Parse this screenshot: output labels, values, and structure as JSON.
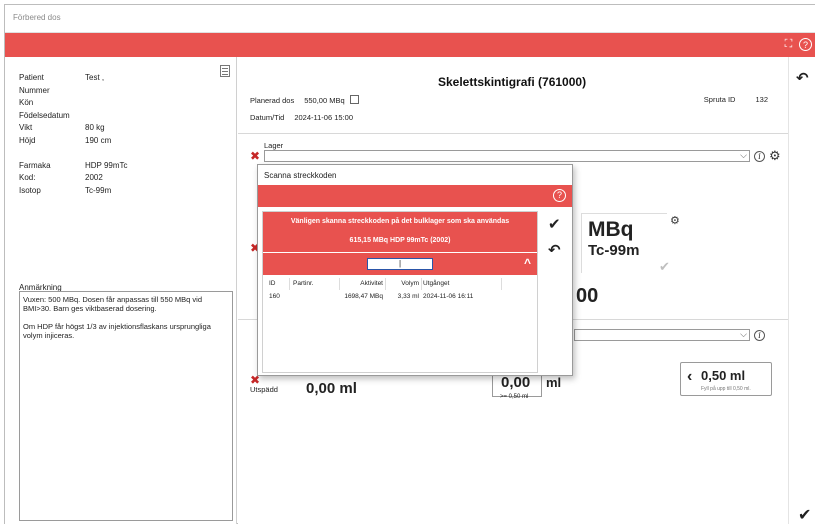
{
  "window": {
    "title": "Förbered dos"
  },
  "patient": {
    "rows": [
      {
        "label": "Patient",
        "value": "Test ,"
      },
      {
        "label": "Nummer",
        "value": ""
      },
      {
        "label": "Kön",
        "value": ""
      },
      {
        "label": "Födelsedatum",
        "value": ""
      },
      {
        "label": "Vikt",
        "value": "80 kg"
      },
      {
        "label": "Höjd",
        "value": "190 cm"
      }
    ],
    "pharma": [
      {
        "label": "Farmaka",
        "value": "HDP 99mTc"
      },
      {
        "label": "Kod:",
        "value": "2002"
      },
      {
        "label": "Isotop",
        "value": "Tc-99m"
      }
    ]
  },
  "notes": {
    "label": "Anmärkning",
    "p1": "Vuxen: 500 MBq. Dosen får anpassas till 550 MBq vid BMI>30. Barn ges viktbaserad dosering.",
    "p2": "Om HDP får högst 1/3 av injektionsflaskans ursprungliga volym injiceras."
  },
  "main": {
    "title": "Skelettskintigrafi (761000)",
    "planned_label": "Planerad dos",
    "planned_value": "550,00 MBq",
    "datetime_label": "Datum/Tid",
    "datetime_value": "2024-11-06 15:00",
    "spruta_label": "Spruta ID",
    "spruta_value": "132",
    "lager_label": "Lager",
    "unit": "MBq",
    "isotope": "Tc-99m",
    "big_value": "00",
    "utspadd_label": "Utspädd",
    "utspadd_value": "0,00 ml",
    "volume_value": "0,00",
    "volume_unit": "ml",
    "volume_min": ">= 0,50 ml",
    "fill_amount": "0,50 ml",
    "fill_sub": "Fyll på upp till 0,50 ml."
  },
  "dialog": {
    "title": "Scanna streckkoden",
    "banner_line1": "Vänligen skanna streckkoden på det bulklager som ska användas",
    "banner_line2": "615,15 MBq  HDP 99mTc  (2002)",
    "scan_value": "|",
    "columns": [
      "ID",
      "Partinr.",
      "Aktivitet",
      "Volym",
      "Utgånget"
    ],
    "rows": [
      {
        "id": "160",
        "partinr": "",
        "aktivitet": "1698,47 MBq",
        "volym": "3,33 ml",
        "utganget": "2024-11-06 16:11"
      }
    ]
  },
  "icons": {
    "expand": "expand-icon",
    "help": "help-icon",
    "undo": "undo-icon",
    "check": "check-icon",
    "gear": "gear-icon",
    "info": "info-icon"
  },
  "colors": {
    "accent": "#e8524f",
    "error": "#c62828"
  }
}
